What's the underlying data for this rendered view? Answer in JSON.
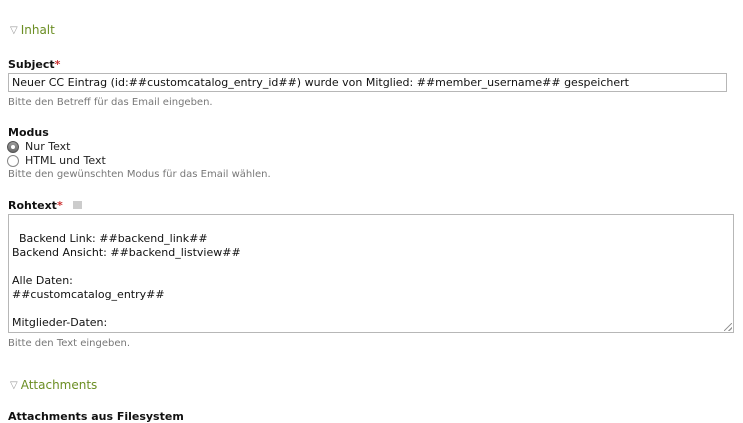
{
  "sections": {
    "inhalt": "Inhalt",
    "attachments": "Attachments"
  },
  "subject": {
    "label": "Subject",
    "required_marker": "*",
    "value": "Neuer CC Eintrag (id:##customcatalog_entry_id##) wurde von Mitglied: ##member_username## gespeichert",
    "help": "Bitte den Betreff für das Email eingeben."
  },
  "modus": {
    "label": "Modus",
    "options": [
      {
        "label": "Nur Text",
        "checked": true
      },
      {
        "label": "HTML und Text",
        "checked": false
      }
    ],
    "help": "Bitte den gewünschten Modus für das Email wählen."
  },
  "rohtext": {
    "label": "Rohtext",
    "required_marker": "*",
    "value": "Backend Link: ##backend_link##\nBackend Ansicht: ##backend_listview##\n\nAlle Daten:\n##customcatalog_entry##\n\nMitglieder-Daten:\n##member##",
    "help": "Bitte den Text eingeben."
  },
  "cut_label": "Attachments aus Filesystem"
}
